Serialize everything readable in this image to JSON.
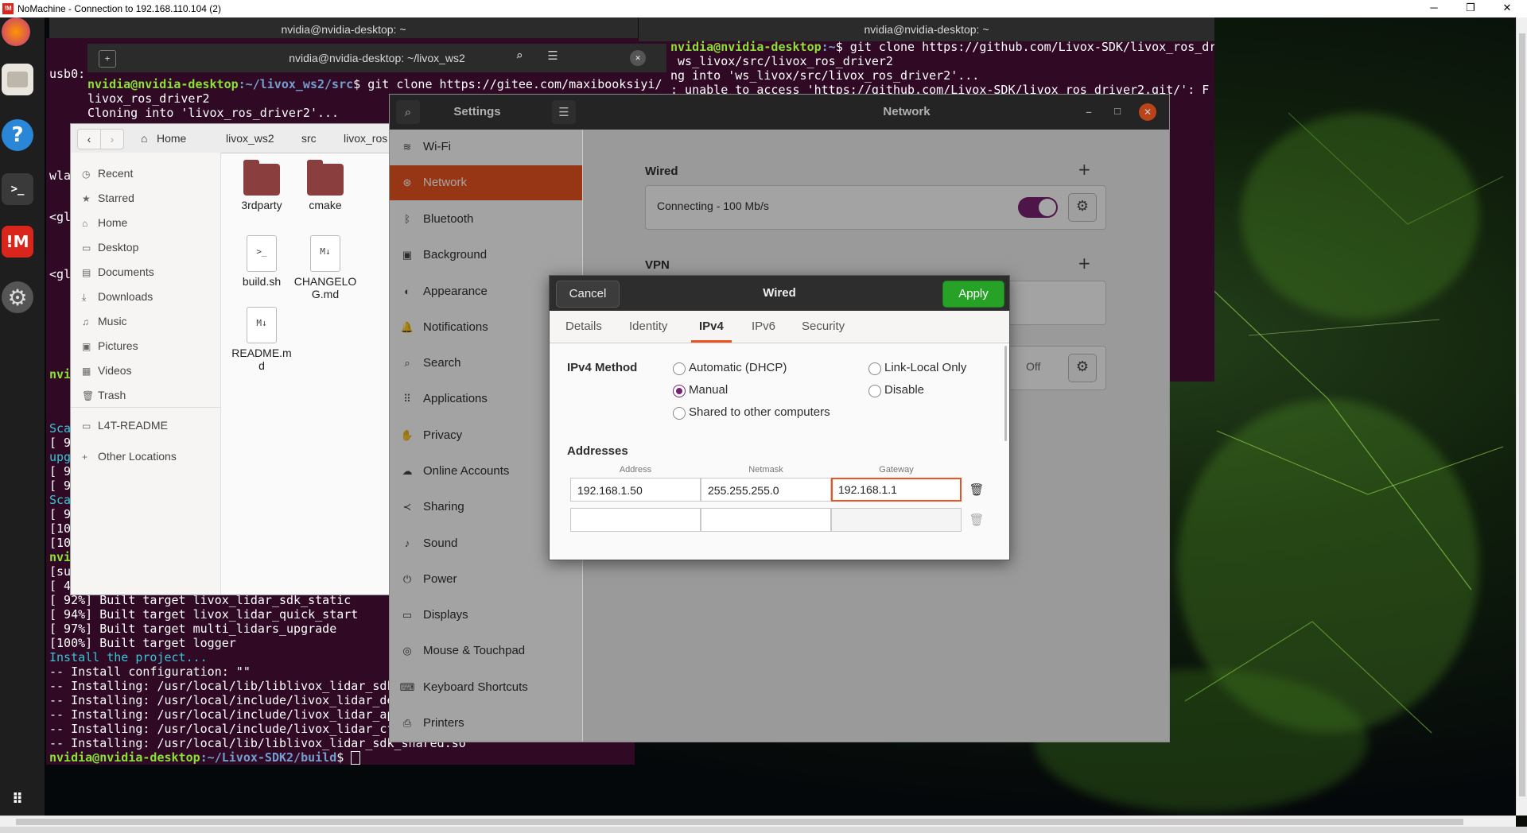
{
  "nomachine": {
    "title": "NoMachine - Connection to 192.168.110.104 (2)",
    "minimize": "─",
    "maximize": "❐",
    "close": "✕"
  },
  "term_top_left": {
    "title": "nvidia@nvidia-desktop: ~"
  },
  "term_top_right": {
    "title": "nvidia@nvidia-desktop: ~",
    "lines": [
      {
        "prompt": "nvidia@nvidia-desktop",
        "path": ":~",
        "cmd": "$ git clone https://github.com/Livox-SDK/livox_ros_driver"
      },
      {
        "text": " ws_livox/src/livox_ros_driver2"
      },
      {
        "text": "ng into 'ws_livox/src/livox_ros_driver2'..."
      },
      {
        "text": ": unable to access 'https://github.com/Livox-SDK/livox_ros_driver2.git/': F"
      }
    ]
  },
  "term_ws2": {
    "title": "nvidia@nvidia-desktop: ~/livox_ws2",
    "line1_prompt": "nvidia@nvidia-desktop",
    "line1_path": ":~/livox_ws2/src",
    "line1_cmd": "$ git clone https://gitee.com/maxibooksiyi/",
    "line2": "livox_ros_driver2",
    "line3": "Cloning into 'livox_ros_driver2'..."
  },
  "left_term_fragments": [
    "usb0:",
    "wla",
    "<gl",
    "<gl",
    "nvi"
  ],
  "term_build": {
    "side_lines": [
      {
        "t": "Sca",
        "c": "cyan"
      },
      {
        "t": "[ 9",
        "c": ""
      },
      {
        "t": "upg",
        "c": "cyan"
      },
      {
        "t": "[ 9",
        "c": ""
      },
      {
        "t": "[ 9",
        "c": ""
      },
      {
        "t": "Sca",
        "c": "cyan"
      },
      {
        "t": "[ 9",
        "c": ""
      },
      {
        "t": "[10",
        "c": ""
      },
      {
        "t": "[10",
        "c": ""
      },
      {
        "t": "nvi",
        "c": "green"
      },
      {
        "t": "[su",
        "c": ""
      },
      {
        "t": "[ 4",
        "c": ""
      }
    ],
    "lines": [
      {
        "t": "[ 92%] Built target livox_lidar_sdk_static",
        "c": ""
      },
      {
        "t": "[ 94%] Built target livox_lidar_quick_start",
        "c": ""
      },
      {
        "t": "[ 97%] Built target multi_lidars_upgrade",
        "c": ""
      },
      {
        "t": "[100%] Built target logger",
        "c": ""
      },
      {
        "t": "Install the project...",
        "c": "cyan"
      },
      {
        "t": "-- Install configuration: \"\"",
        "c": ""
      },
      {
        "t": "-- Installing: /usr/local/lib/liblivox_lidar_sdk",
        "c": ""
      },
      {
        "t": "-- Installing: /usr/local/include/livox_lidar_de",
        "c": ""
      },
      {
        "t": "-- Installing: /usr/local/include/livox_lidar_ap",
        "c": ""
      },
      {
        "t": "-- Installing: /usr/local/include/livox_lidar_cf",
        "c": ""
      },
      {
        "t": "-- Installing: /usr/local/lib/liblivox_lidar_sdk_shared.so",
        "c": ""
      }
    ],
    "prompt": "nvidia@nvidia-desktop",
    "path": ":~/Livox-SDK2/build",
    "suffix": "$ "
  },
  "files": {
    "crumbs": [
      "Home",
      "livox_ws2",
      "src",
      "livox_ros"
    ],
    "sidebar": [
      {
        "icon": "◷",
        "label": "Recent"
      },
      {
        "icon": "★",
        "label": "Starred"
      },
      {
        "icon": "⌂",
        "label": "Home"
      },
      {
        "icon": "▭",
        "label": "Desktop"
      },
      {
        "icon": "▤",
        "label": "Documents"
      },
      {
        "icon": "⤓",
        "label": "Downloads"
      },
      {
        "icon": "♫",
        "label": "Music"
      },
      {
        "icon": "▣",
        "label": "Pictures"
      },
      {
        "icon": "▦",
        "label": "Videos"
      },
      {
        "icon": "🗑",
        "label": "Trash"
      },
      {
        "icon": "▭",
        "label": "L4T-README"
      },
      {
        "icon": "+",
        "label": "Other Locations"
      }
    ],
    "items": [
      {
        "name": "3rdparty",
        "type": "folder"
      },
      {
        "name": "cmake",
        "type": "folder"
      },
      {
        "name": "build.sh",
        "type": "script"
      },
      {
        "name": "CHANGELOG.md",
        "type": "md"
      },
      {
        "name": "README.md",
        "type": "md"
      }
    ]
  },
  "settings": {
    "title": "Settings",
    "panel_title": "Network",
    "menu": [
      {
        "icon": "wifi-icon",
        "glyph": "≋",
        "label": "Wi-Fi"
      },
      {
        "icon": "network-icon",
        "glyph": "⊛",
        "label": "Network",
        "active": true
      },
      {
        "icon": "bluetooth-icon",
        "glyph": "ᛒ",
        "label": "Bluetooth"
      },
      {
        "icon": "background-icon",
        "glyph": "▣",
        "label": "Background"
      },
      {
        "icon": "appearance-icon",
        "glyph": "◐",
        "label": "Appearance"
      },
      {
        "icon": "notifications-icon",
        "glyph": "🔔",
        "label": "Notifications"
      },
      {
        "icon": "search-icon",
        "glyph": "⌕",
        "label": "Search"
      },
      {
        "icon": "applications-icon",
        "glyph": "⠿",
        "label": "Applications"
      },
      {
        "icon": "privacy-icon",
        "glyph": "✋",
        "label": "Privacy"
      },
      {
        "icon": "online-accounts-icon",
        "glyph": "☁",
        "label": "Online Accounts"
      },
      {
        "icon": "sharing-icon",
        "glyph": "≺",
        "label": "Sharing"
      },
      {
        "icon": "sound-icon",
        "glyph": "♪",
        "label": "Sound"
      },
      {
        "icon": "power-icon",
        "glyph": "⏻",
        "label": "Power"
      },
      {
        "icon": "displays-icon",
        "glyph": "▭",
        "label": "Displays"
      },
      {
        "icon": "mouse-icon",
        "glyph": "◎",
        "label": "Mouse & Touchpad"
      },
      {
        "icon": "keyboard-icon",
        "glyph": "⌨",
        "label": "Keyboard Shortcuts"
      },
      {
        "icon": "printers-icon",
        "glyph": "⎙",
        "label": "Printers"
      }
    ],
    "wired_title": "Wired",
    "wired_status": "Connecting - 100 Mb/s",
    "vpn_title": "VPN",
    "proxy_status": "Off"
  },
  "dialog": {
    "title": "Wired",
    "cancel": "Cancel",
    "apply": "Apply",
    "tabs": [
      "Details",
      "Identity",
      "IPv4",
      "IPv6",
      "Security"
    ],
    "active_tab": "IPv4",
    "method_label": "IPv4 Method",
    "methods": {
      "auto": "Automatic (DHCP)",
      "manual": "Manual",
      "shared": "Shared to other computers",
      "link_local": "Link-Local Only",
      "disable": "Disable"
    },
    "selected_method": "Manual",
    "addresses_label": "Addresses",
    "col_address": "Address",
    "col_netmask": "Netmask",
    "col_gateway": "Gateway",
    "row1": {
      "address": "192.168.1.50",
      "netmask": "255.255.255.0",
      "gateway": "192.168.1.1"
    },
    "row2": {
      "address": "",
      "netmask": "",
      "gateway": ""
    }
  },
  "colors": {
    "accent": "#e95420",
    "apply_green": "#26a326",
    "toggle": "#77216f",
    "terminal_bg": "#300a24"
  }
}
